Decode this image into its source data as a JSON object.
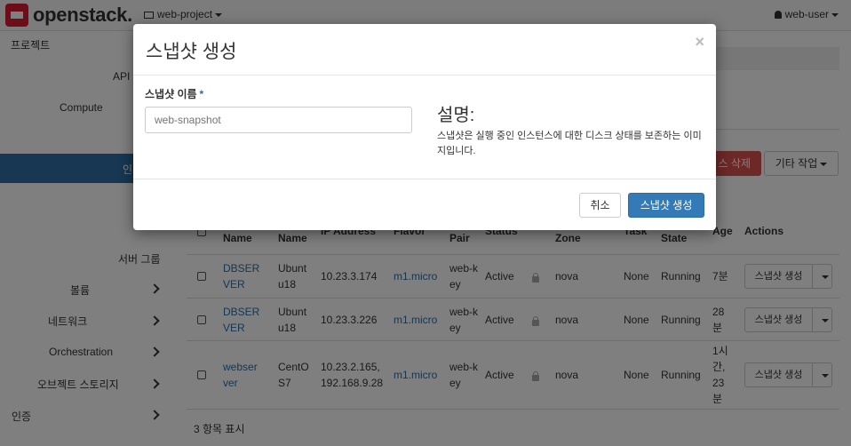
{
  "header": {
    "logo_text": "openstack.",
    "project": "web-project",
    "user": "web-user"
  },
  "sidebar": {
    "project": "프로젝트",
    "api": "API",
    "compute": "Compute",
    "active_item": "인",
    "items": [
      {
        "label": "서버 그룹"
      },
      {
        "label": "볼륨"
      },
      {
        "label": "네트워크"
      },
      {
        "label": "Orchestration"
      },
      {
        "label": "오브젝트 스토리지"
      },
      {
        "label": "인증"
      }
    ]
  },
  "toolbar": {
    "delete_label": "스 삭제",
    "more_label": "기타 작업"
  },
  "table": {
    "headers": {
      "name": "Name",
      "image": "Name",
      "ip": "IP Address",
      "flavor": "Flavor",
      "pair": "Pair",
      "status": "Status",
      "zone": "Zone",
      "task": "Task",
      "state": "State",
      "age": "Age",
      "actions": "Actions"
    },
    "rows": [
      {
        "name": "DBSERVER",
        "image": "Ubuntu18",
        "ip": "10.23.3.174",
        "flavor": "m1.micro",
        "key": "web-key",
        "status": "Active",
        "zone": "nova",
        "task": "None",
        "state": "Running",
        "age": "7분",
        "action": "스냅샷 생성"
      },
      {
        "name": "DBSERVER",
        "image": "Ubuntu18",
        "ip": "10.23.3.226",
        "flavor": "m1.micro",
        "key": "web-key",
        "status": "Active",
        "zone": "nova",
        "task": "None",
        "state": "Running",
        "age": "28분",
        "action": "스냅샷 생성"
      },
      {
        "name": "webserver",
        "image": "CentOS7",
        "ip": "10.23.2.165, 192.168.9.28",
        "flavor": "m1.micro",
        "key": "web-key",
        "status": "Active",
        "zone": "nova",
        "task": "None",
        "state": "Running",
        "age": "1시간, 23분",
        "action": "스냅샷 생성"
      }
    ],
    "footer": "3 항목 표시"
  },
  "modal": {
    "title": "스냅샷 생성",
    "close": "×",
    "name_label": "스냅샷 이름",
    "required_mark": "*",
    "name_placeholder": "web-snapshot",
    "name_value": "",
    "description_title": "설명:",
    "description_text": "스냅샷은 실행 중인 인스턴스에 대한 디스크 상태를 보존하는 이미지입니다.",
    "cancel_label": "취소",
    "submit_label": "스냅샷 생성"
  },
  "colors": {
    "primary": "#337ab7",
    "danger": "#d9534f",
    "link": "#2a6ea8",
    "sidebar_active": "#2e6ea5"
  }
}
